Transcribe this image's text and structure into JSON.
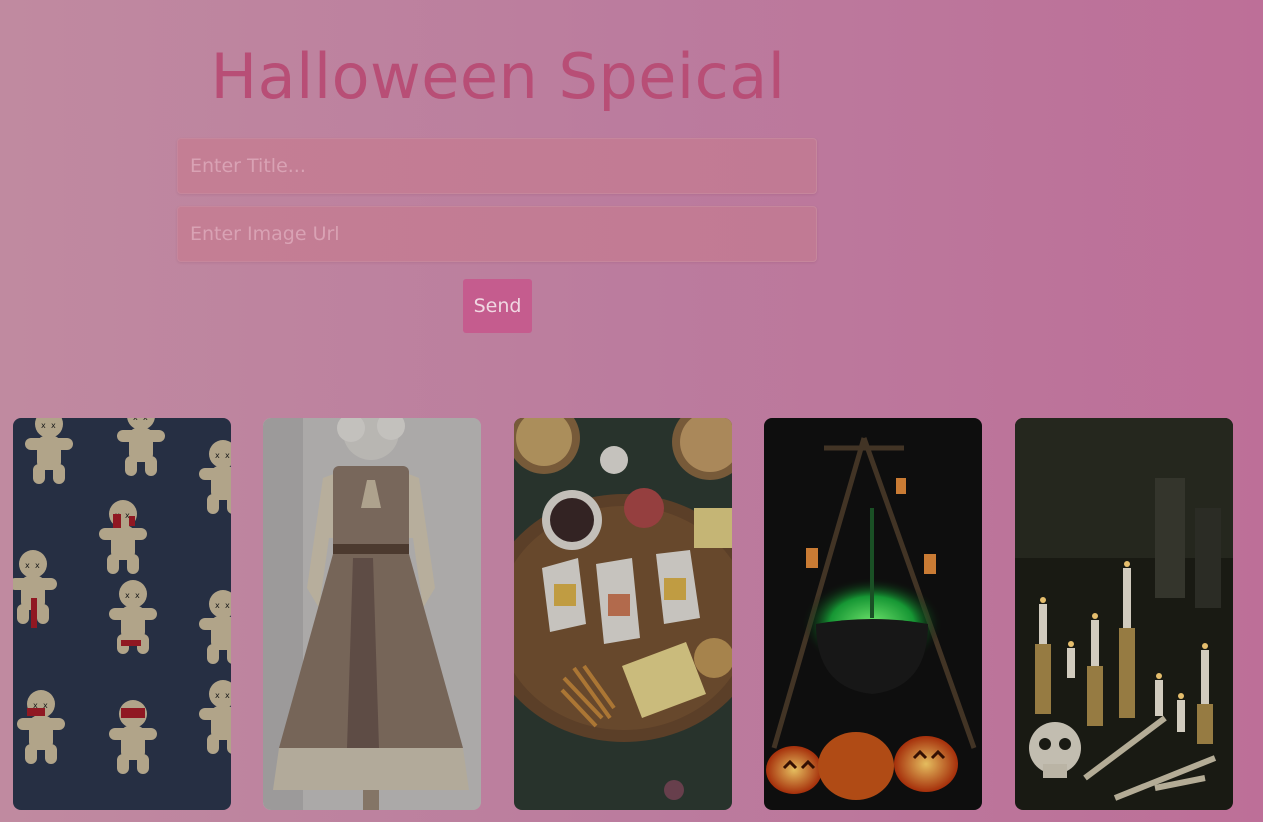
{
  "header": {
    "title": "Halloween Speical"
  },
  "form": {
    "title_placeholder": "Enter Title...",
    "title_value": "",
    "url_placeholder": "Enter Image Url",
    "url_value": "",
    "send_label": "Send"
  },
  "gallery": {
    "images": [
      {
        "subject": "gingerbread-zombie-cookies"
      },
      {
        "subject": "vintage-brown-dress"
      },
      {
        "subject": "halloween-snack-board"
      },
      {
        "subject": "witch-cauldron-pumpkins"
      },
      {
        "subject": "skull-candles-table"
      }
    ]
  },
  "colors": {
    "background_start": "#c08aa0",
    "background_end": "#bd6f98",
    "title": "#b84e76",
    "button": "#c55c8e"
  }
}
